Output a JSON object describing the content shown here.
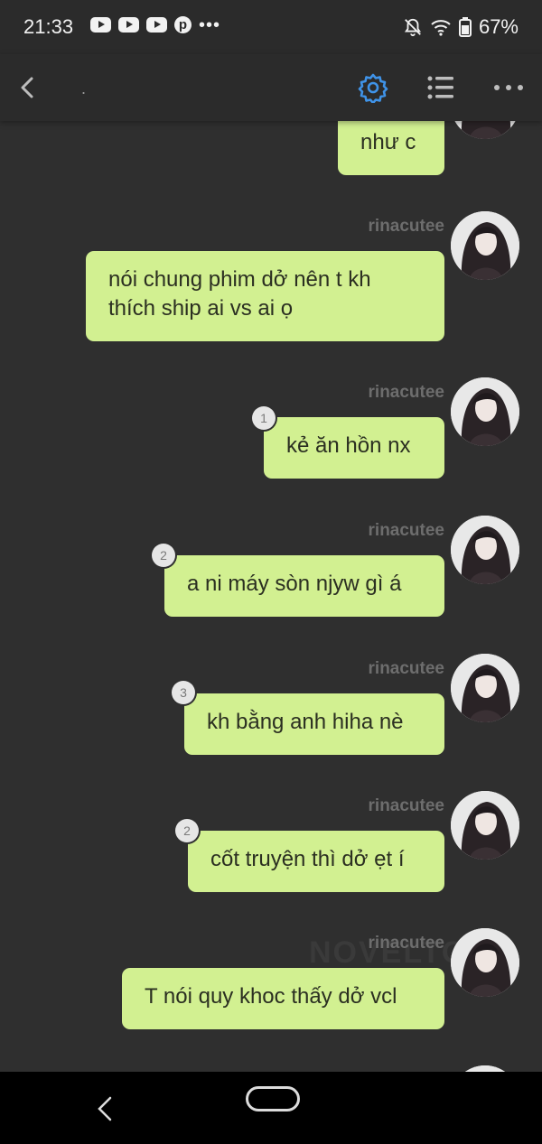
{
  "status_bar": {
    "time": "21:33",
    "battery": "67%",
    "icons": [
      "youtube-icon",
      "youtube-icon",
      "youtube-icon",
      "pinterest-icon",
      "more-dots-icon",
      "bell-off-icon",
      "wifi-icon",
      "battery-icon"
    ]
  },
  "header": {
    "title": ".",
    "icons": [
      "back-icon",
      "gear-icon",
      "list-icon",
      "more-icon"
    ],
    "accent": "#3f93e8"
  },
  "messages": [
    {
      "author": "",
      "text": "như c"
    },
    {
      "author": "rinacutee",
      "text": "nói chung phim dở nên t kh\nthích ship ai vs ai ọ"
    },
    {
      "author": "rinacutee",
      "text": "kẻ ăn hồn nx",
      "badge": "1"
    },
    {
      "author": "rinacutee",
      "text": "a ni máy sòn njyw gì á",
      "badge": "2"
    },
    {
      "author": "rinacutee",
      "text": "kh bằng anh hiha nè",
      "badge": "3"
    },
    {
      "author": "rinacutee",
      "text": "cốt truyện thì dở ẹt í",
      "badge": "2"
    },
    {
      "author": "rinacutee",
      "text": "T nói quy khoc thấy dở vcl"
    }
  ],
  "watermark": "NOVELTO",
  "colors": {
    "bubble": "#d2f091",
    "background": "#2f2f2f",
    "author": "#6d6d6d"
  }
}
